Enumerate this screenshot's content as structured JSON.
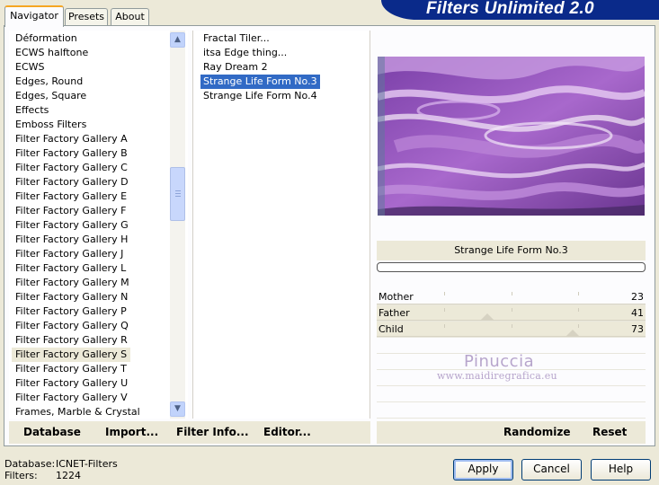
{
  "tabs": [
    "Navigator",
    "Presets",
    "About"
  ],
  "banner": "Filters Unlimited 2.0",
  "categories": [
    "Déformation",
    "ECWS halftone",
    "ECWS",
    "Edges, Round",
    "Edges, Square",
    "Effects",
    "Emboss Filters",
    "Filter Factory Gallery A",
    "Filter Factory Gallery B",
    "Filter Factory Gallery C",
    "Filter Factory Gallery D",
    "Filter Factory Gallery E",
    "Filter Factory Gallery F",
    "Filter Factory Gallery G",
    "Filter Factory Gallery H",
    "Filter Factory Gallery J",
    "Filter Factory Gallery L",
    "Filter Factory Gallery M",
    "Filter Factory Gallery N",
    "Filter Factory Gallery P",
    "Filter Factory Gallery Q",
    "Filter Factory Gallery R",
    "Filter Factory Gallery S",
    "Filter Factory Gallery T",
    "Filter Factory Gallery U",
    "Filter Factory Gallery V",
    "Frames, Marble & Crystal"
  ],
  "selected_category": "Filter Factory Gallery S",
  "filters": [
    "Fractal Tiler...",
    "itsa Edge thing...",
    "Ray Dream 2",
    "Strange Life Form No.3",
    "Strange Life Form No.4"
  ],
  "selected_filter": "Strange Life Form No.3",
  "preview": {
    "filter_name": "Strange Life Form No.3",
    "progress": 0
  },
  "sliders": [
    {
      "label": "Mother",
      "value": "23",
      "fraction": 0.23
    },
    {
      "label": "Father",
      "value": "41",
      "fraction": 0.41
    },
    {
      "label": "Child",
      "value": "73",
      "fraction": 0.73
    }
  ],
  "watermark": {
    "name": "Pinuccia",
    "url": "www.maidiregrafica.eu"
  },
  "left_bar": {
    "database": "Database",
    "import": "Import...",
    "filter_info": "Filter Info...",
    "editor": "Editor..."
  },
  "right_bar": {
    "randomize": "Randomize",
    "reset": "Reset"
  },
  "status": {
    "database_label": "Database:",
    "database_value": "ICNET-Filters",
    "filters_label": "Filters:",
    "filters_value": "1224"
  },
  "buttons": {
    "apply": "Apply",
    "cancel": "Cancel",
    "help": "Help"
  },
  "colors": {
    "selection": "#316ac5",
    "banner": "#0a2a8a",
    "window": "#ece9d8"
  }
}
